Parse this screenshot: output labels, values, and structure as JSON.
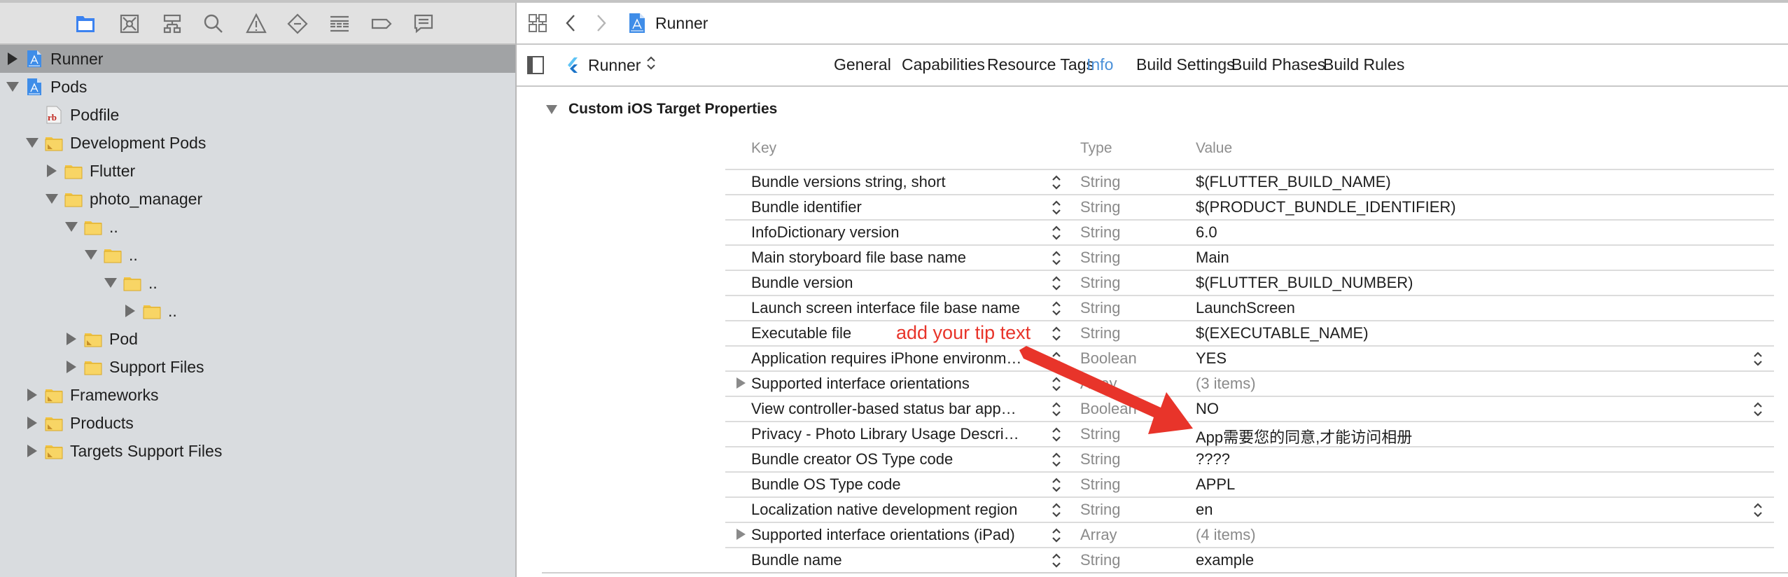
{
  "navigator": {
    "toolbar_icons": [
      {
        "name": "project-navigator-icon",
        "active": true
      },
      {
        "name": "source-control-navigator-icon",
        "active": false
      },
      {
        "name": "symbol-navigator-icon",
        "active": false
      },
      {
        "name": "find-navigator-icon",
        "active": false
      },
      {
        "name": "issue-navigator-icon",
        "active": false
      },
      {
        "name": "test-navigator-icon",
        "active": false
      },
      {
        "name": "debug-navigator-icon",
        "active": false
      },
      {
        "name": "breakpoint-navigator-icon",
        "active": false
      },
      {
        "name": "report-navigator-icon",
        "active": false
      }
    ],
    "tree": [
      {
        "label": "Runner",
        "depth": 0,
        "disclosure": "collapsed",
        "icon": "xcode-project-icon",
        "selected": true
      },
      {
        "label": "Pods",
        "depth": 0,
        "disclosure": "expanded",
        "icon": "xcode-project-icon"
      },
      {
        "label": "Podfile",
        "depth": 1,
        "disclosure": "none",
        "icon": "ruby-file-icon"
      },
      {
        "label": "Development Pods",
        "depth": 1,
        "disclosure": "expanded",
        "icon": "group-folder-icon"
      },
      {
        "label": "Flutter",
        "depth": 2,
        "disclosure": "collapsed",
        "icon": "folder-icon"
      },
      {
        "label": "photo_manager",
        "depth": 2,
        "disclosure": "expanded",
        "icon": "folder-icon"
      },
      {
        "label": "..",
        "depth": 3,
        "disclosure": "expanded",
        "icon": "folder-icon"
      },
      {
        "label": "..",
        "depth": 4,
        "disclosure": "expanded",
        "icon": "folder-icon"
      },
      {
        "label": "..",
        "depth": 5,
        "disclosure": "expanded",
        "icon": "folder-icon"
      },
      {
        "label": "..",
        "depth": 6,
        "disclosure": "collapsed",
        "icon": "folder-icon"
      },
      {
        "label": "Pod",
        "depth": 3,
        "disclosure": "collapsed",
        "icon": "group-folder-icon"
      },
      {
        "label": "Support Files",
        "depth": 3,
        "disclosure": "collapsed",
        "icon": "folder-icon"
      },
      {
        "label": "Frameworks",
        "depth": 1,
        "disclosure": "collapsed",
        "icon": "group-folder-icon"
      },
      {
        "label": "Products",
        "depth": 1,
        "disclosure": "collapsed",
        "icon": "group-folder-icon"
      },
      {
        "label": "Targets Support Files",
        "depth": 1,
        "disclosure": "collapsed",
        "icon": "group-folder-icon"
      }
    ]
  },
  "jumpbar": {
    "title": "Runner"
  },
  "target_selector": {
    "label": "Runner"
  },
  "tabs": [
    {
      "label": "General",
      "active": false
    },
    {
      "label": "Capabilities",
      "active": false
    },
    {
      "label": "Resource Tags",
      "active": false
    },
    {
      "label": "Info",
      "active": true
    },
    {
      "label": "Build Settings",
      "active": false
    },
    {
      "label": "Build Phases",
      "active": false
    },
    {
      "label": "Build Rules",
      "active": false
    }
  ],
  "section": {
    "title": "Custom iOS Target Properties"
  },
  "columns": {
    "key": "Key",
    "type": "Type",
    "value": "Value"
  },
  "properties": [
    {
      "key": "Bundle versions string, short",
      "type": "String",
      "value": "$(FLUTTER_BUILD_NAME)"
    },
    {
      "key": "Bundle identifier",
      "type": "String",
      "value": "$(PRODUCT_BUNDLE_IDENTIFIER)"
    },
    {
      "key": "InfoDictionary version",
      "type": "String",
      "value": "6.0"
    },
    {
      "key": "Main storyboard file base name",
      "type": "String",
      "value": "Main"
    },
    {
      "key": "Bundle version",
      "type": "String",
      "value": "$(FLUTTER_BUILD_NUMBER)"
    },
    {
      "key": "Launch screen interface file base name",
      "type": "String",
      "value": "LaunchScreen"
    },
    {
      "key": "Executable file",
      "type": "String",
      "value": "$(EXECUTABLE_NAME)"
    },
    {
      "key": "Application requires iPhone environm…",
      "type": "Boolean",
      "value": "YES",
      "value_popup": true
    },
    {
      "key": "Supported interface orientations",
      "type": "Array",
      "value": "(3 items)",
      "expandable": true,
      "muted": true
    },
    {
      "key": "View controller-based status bar app…",
      "type": "Boolean",
      "value": "NO",
      "value_popup": true
    },
    {
      "key": "Privacy - Photo Library Usage Descri…",
      "type": "String",
      "value": "App需要您的同意,才能访问相册"
    },
    {
      "key": "Bundle creator OS Type code",
      "type": "String",
      "value": "????"
    },
    {
      "key": "Bundle OS Type code",
      "type": "String",
      "value": "APPL"
    },
    {
      "key": "Localization native development region",
      "type": "String",
      "value": "en",
      "value_popup": true
    },
    {
      "key": "Supported interface orientations (iPad)",
      "type": "Array",
      "value": "(4 items)",
      "expandable": true,
      "muted": true
    },
    {
      "key": "Bundle name",
      "type": "String",
      "value": "example"
    }
  ],
  "annotation": {
    "text": "add your tip text",
    "color": "#e8342a"
  },
  "colors": {
    "accent": "#4a90d9",
    "sidebar_bg": "#d9dcdf",
    "selection": "#a1a3a5",
    "folder": "#f7cf55"
  }
}
